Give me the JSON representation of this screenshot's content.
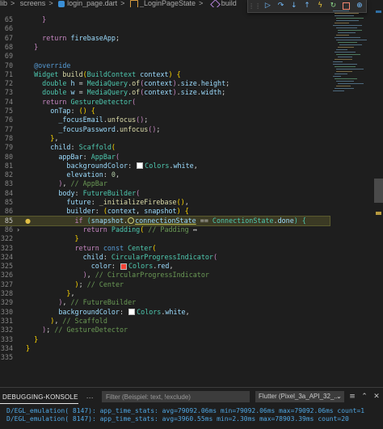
{
  "breadcrumb": {
    "items": [
      "lib",
      "screens",
      "login_page.dart",
      "_LoginPageState",
      "build"
    ],
    "sep": ">"
  },
  "debug_toolbar": {
    "icons": [
      "drag-grip-icon",
      "continue-icon",
      "step-over-icon",
      "step-into-icon",
      "step-out-icon",
      "hot-reload-icon",
      "restart-icon",
      "stop-icon",
      "devtools-icon"
    ]
  },
  "editor": {
    "lines": [
      {
        "n": "65",
        "code": "    }"
      },
      {
        "n": "66",
        "code": ""
      },
      {
        "n": "67",
        "code": "    return firebaseApp;"
      },
      {
        "n": "68",
        "code": "  }"
      },
      {
        "n": "69",
        "code": ""
      },
      {
        "n": "70",
        "code": "  @override"
      },
      {
        "n": "71",
        "code": "  Widget build(BuildContext context) {"
      },
      {
        "n": "72",
        "code": "    double h = MediaQuery.of(context).size.height;"
      },
      {
        "n": "73",
        "code": "    double w = MediaQuery.of(context).size.width;"
      },
      {
        "n": "74",
        "code": "    return GestureDetector("
      },
      {
        "n": "75",
        "code": "      onTap: () {"
      },
      {
        "n": "76",
        "code": "        _focusEmail.unfocus();"
      },
      {
        "n": "77",
        "code": "        _focusPassword.unfocus();"
      },
      {
        "n": "78",
        "code": "      },"
      },
      {
        "n": "79",
        "code": "      child: Scaffold("
      },
      {
        "n": "80",
        "code": "        appBar: AppBar("
      },
      {
        "n": "81",
        "code": "          backgroundColor: Colors.white,"
      },
      {
        "n": "82",
        "code": "          elevation: 0,"
      },
      {
        "n": "83",
        "code": "        ), // AppBar"
      },
      {
        "n": "84",
        "code": "        body: FutureBuilder("
      },
      {
        "n": "85",
        "code": "          future: _initializeFirebase(),"
      },
      {
        "n": "86",
        "code": "          builder: (context, snapshot) {"
      },
      {
        "n": "85",
        "code": "            if (snapshot.connectionState == ConnectionState.done) {"
      },
      {
        "n": "86",
        "code": "              return Padding( // Padding ↔"
      },
      {
        "n": "322",
        "code": "            }"
      },
      {
        "n": "323",
        "code": "            return const Center("
      },
      {
        "n": "324",
        "code": "              child: CircularProgressIndicator("
      },
      {
        "n": "325",
        "code": "                color: Colors.red,"
      },
      {
        "n": "326",
        "code": "              ), // CircularProgressIndicator"
      },
      {
        "n": "327",
        "code": "            ); // Center"
      },
      {
        "n": "328",
        "code": "          },"
      },
      {
        "n": "329",
        "code": "        ), // FutureBuilder"
      },
      {
        "n": "330",
        "code": "        backgroundColor: Colors.white,"
      },
      {
        "n": "331",
        "code": "      ), // Scaffold"
      },
      {
        "n": "332",
        "code": "    ); // GestureDetector"
      },
      {
        "n": "333",
        "code": "  }"
      },
      {
        "n": "334",
        "code": "}"
      },
      {
        "n": "335",
        "code": ""
      }
    ]
  },
  "panel": {
    "tab_label": "DEBUGGING-KONSOLE",
    "more_label": "···",
    "filter_placeholder": "Filter (Beispiel: text, !exclude)",
    "device_label": "Flutter (Pixel_3a_API_32_...",
    "icons": [
      "clear-console-icon",
      "maximize-panel-icon",
      "close-panel-icon"
    ],
    "console_lines": [
      "D/EGL_emulation( 8147): app_time_stats: avg=79092.06ms min=79092.06ms max=79092.06ms count=1",
      "D/EGL_emulation( 8147): app_time_stats: avg=3960.55ms min=2.30ms max=78903.39ms count=20"
    ]
  },
  "colors": {
    "editor_bg": "#1e1e1e",
    "keyword": "#569cd6",
    "control": "#c586c0",
    "class": "#4ec9b0",
    "function": "#dcdcaa",
    "variable": "#9cdcfe",
    "number": "#b5cea8",
    "comment": "#6a9955",
    "console_text": "#4fa7e3",
    "current_line_bg": "#3b3a24"
  }
}
